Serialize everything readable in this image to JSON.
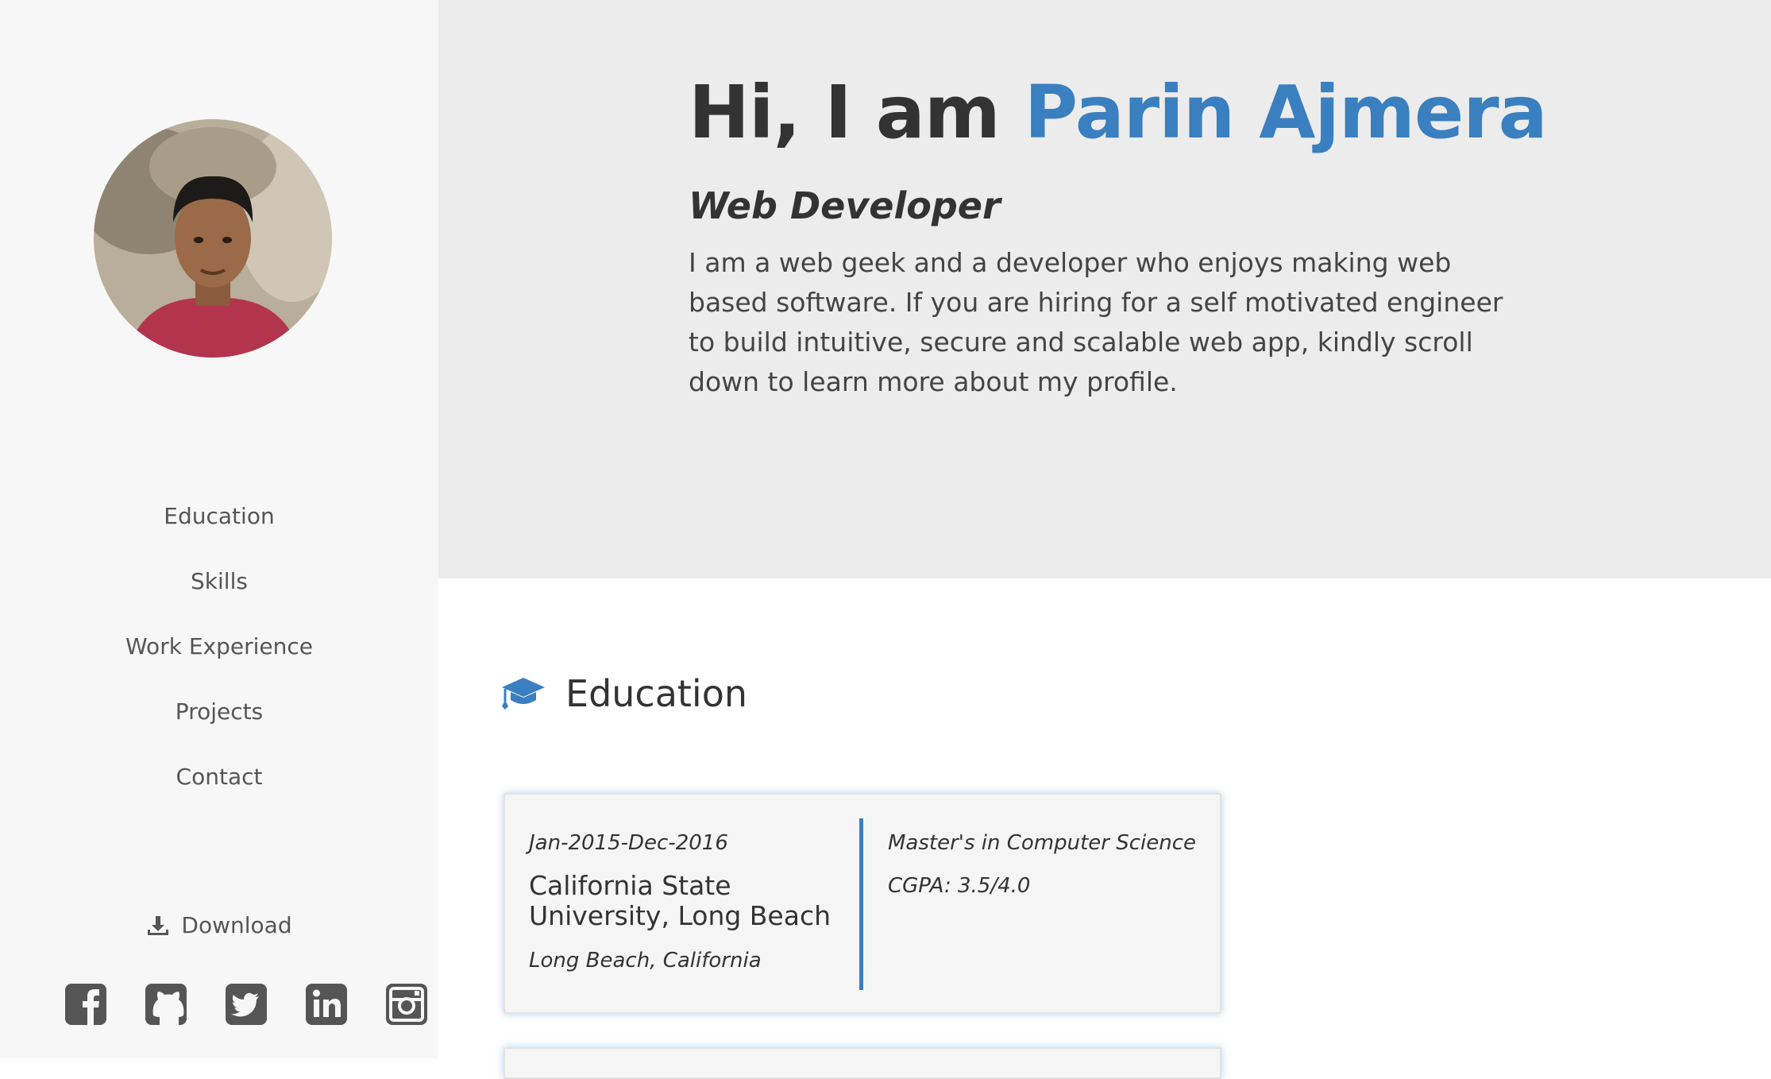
{
  "sidebar": {
    "nav": [
      "Education",
      "Skills",
      "Work Experience",
      "Projects",
      "Contact"
    ],
    "download_label": "Download",
    "socials": [
      "facebook-icon",
      "github-icon",
      "twitter-icon",
      "linkedin-icon",
      "instagram-icon"
    ]
  },
  "hero": {
    "greeting": "Hi, I am ",
    "name": "Parin Ajmera",
    "role": "Web Developer",
    "description": "I am a web geek and a developer who enjoys making web based software. If you are hiring for a self motivated engineer to build intuitive, secure and scalable web app, kindly scroll down to learn more about my profile."
  },
  "education": {
    "title": "Education",
    "entries": [
      {
        "dates": "Jan-2015-Dec-2016",
        "university": "California State University, Long Beach",
        "location": "Long Beach, California",
        "degree": "Master's in Computer Science",
        "cgpa": "CGPA: 3.5/4.0"
      }
    ]
  },
  "colors": {
    "accent": "#3a7fbf",
    "sidebar_bg": "#f7f7f7",
    "hero_bg": "#ececec",
    "text": "#333333"
  }
}
